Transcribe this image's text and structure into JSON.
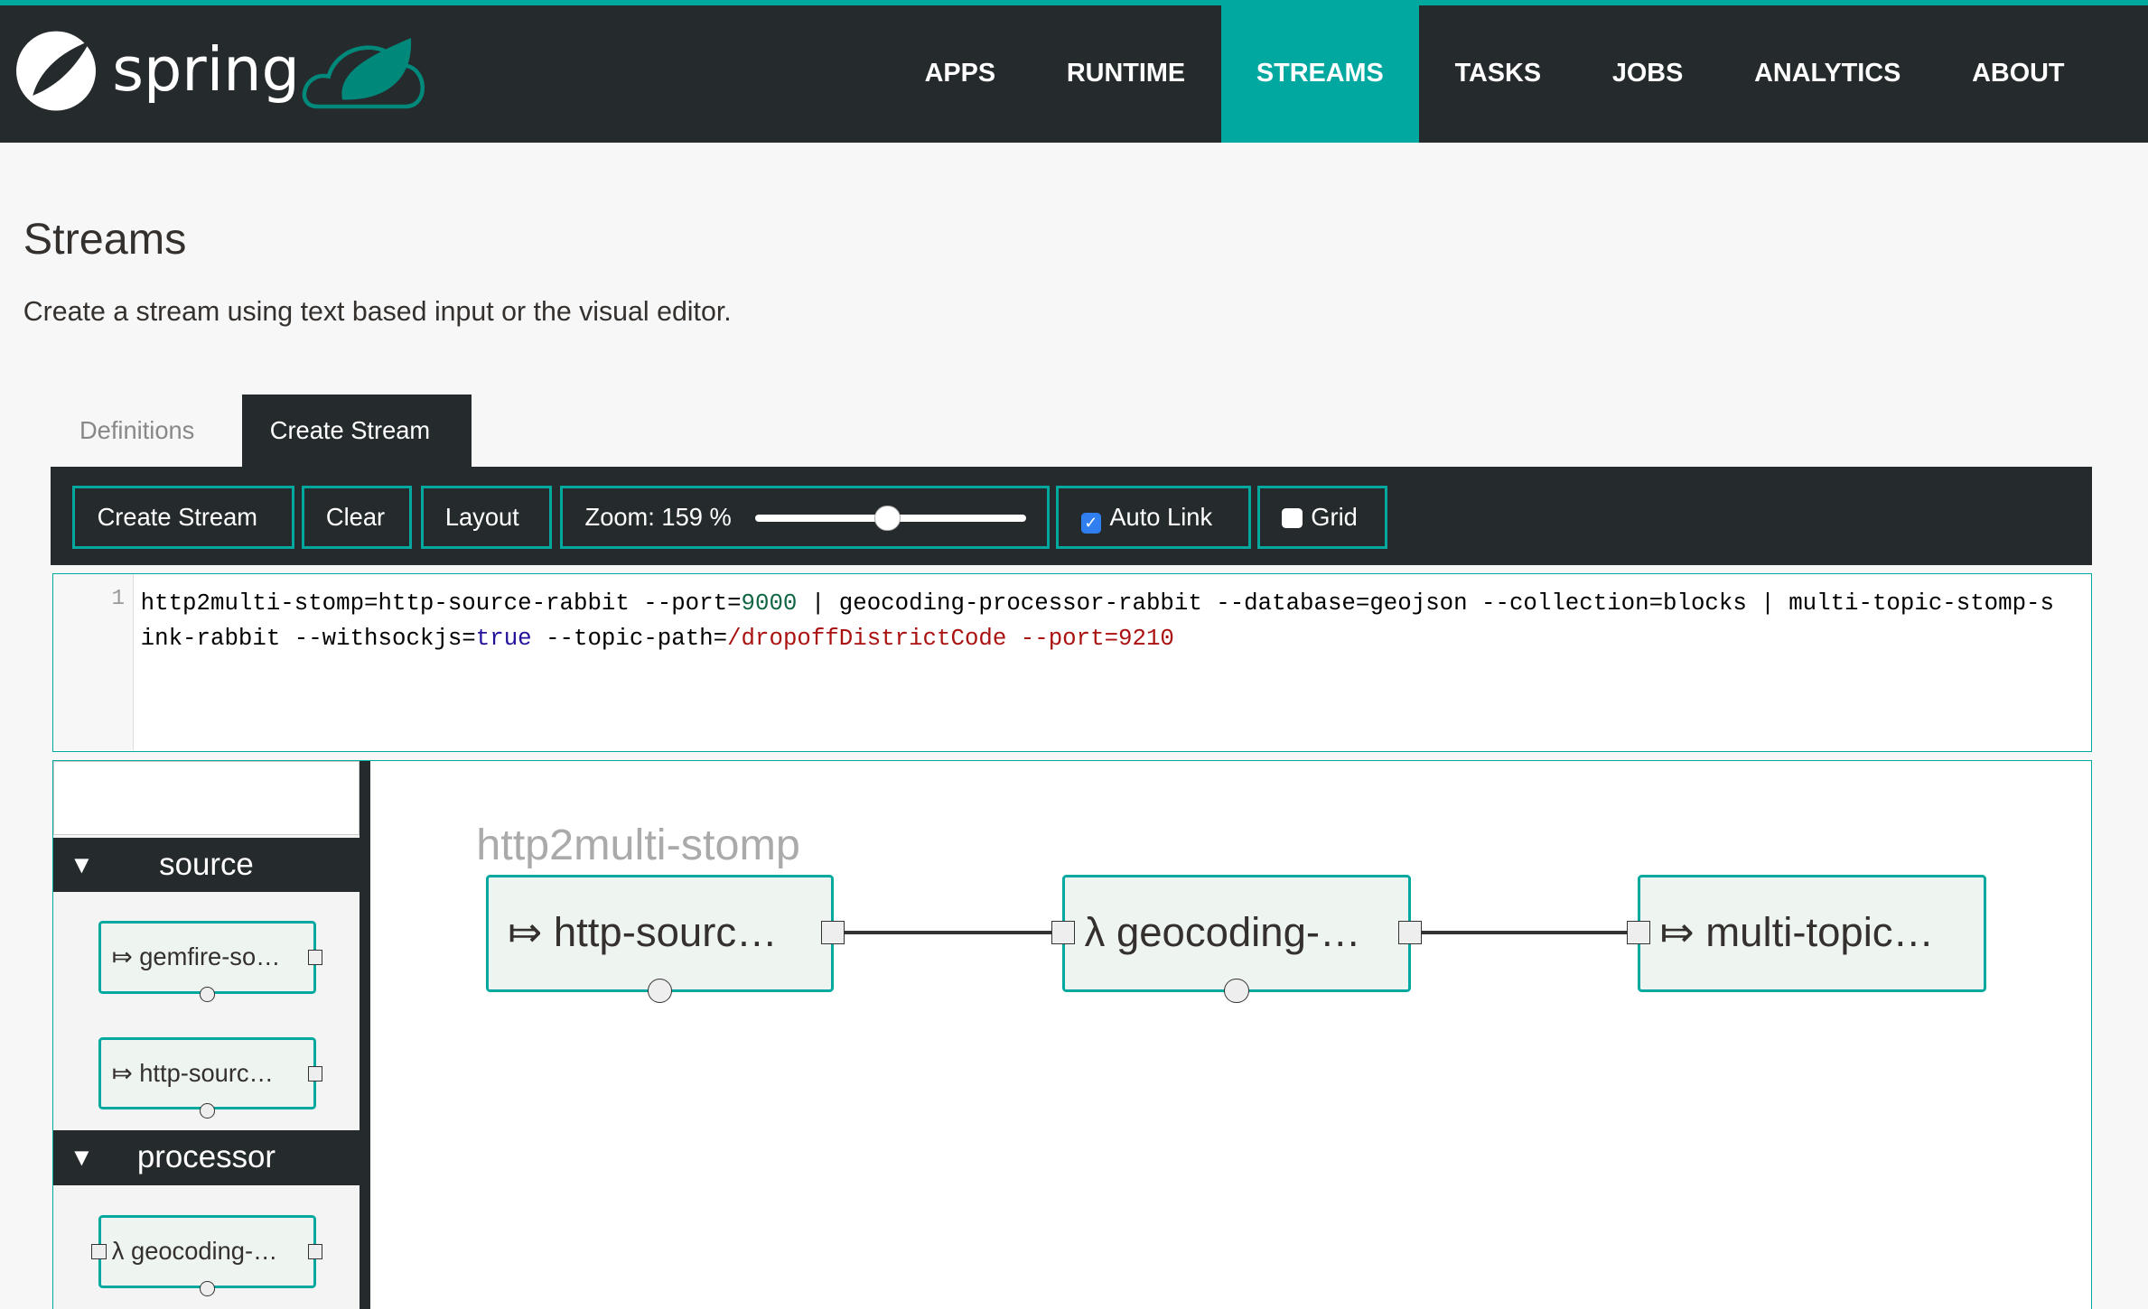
{
  "brand": {
    "logo_text": "spring"
  },
  "nav": {
    "items": [
      {
        "label": "APPS"
      },
      {
        "label": "RUNTIME"
      },
      {
        "label": "STREAMS",
        "active": true
      },
      {
        "label": "TASKS"
      },
      {
        "label": "JOBS"
      },
      {
        "label": "ANALYTICS"
      },
      {
        "label": "ABOUT"
      }
    ]
  },
  "page": {
    "title": "Streams",
    "subtitle": "Create a stream using text based input or the visual editor."
  },
  "tabs": [
    {
      "label": "Definitions"
    },
    {
      "label": "Create Stream",
      "active": true
    }
  ],
  "toolbar": {
    "create": "Create Stream",
    "clear": "Clear",
    "layout": "Layout",
    "zoom_label": "Zoom: 159 %",
    "zoom_value": 159,
    "auto_link": "Auto Link",
    "auto_link_checked": true,
    "grid": "Grid",
    "grid_checked": false
  },
  "editor": {
    "line_number": "1",
    "tokens": [
      {
        "t": "http2multi-stomp=http-source-rabbit --port=",
        "c": ""
      },
      {
        "t": "9000",
        "c": "num"
      },
      {
        "t": " | geocoding-processor-rabbit --database=geojson --collection=blocks | multi-topic-stomp-sink-rabbit --withsockjs=",
        "c": ""
      },
      {
        "t": "true",
        "c": "kw"
      },
      {
        "t": " --topic-path=",
        "c": ""
      },
      {
        "t": "/dropoffDistrictCode --port=9210",
        "c": "str"
      }
    ]
  },
  "palette": {
    "search_placeholder": "",
    "groups": [
      {
        "label": "source",
        "items": [
          {
            "icon": "⤇",
            "label": "gemfire-so…"
          },
          {
            "icon": "⤇",
            "label": "http-sourc…"
          }
        ]
      },
      {
        "label": "processor",
        "items": [
          {
            "icon": "λ",
            "label": "geocoding-…"
          }
        ]
      }
    ]
  },
  "canvas": {
    "stream_name": "http2multi-stomp",
    "nodes": [
      {
        "icon": "⤇",
        "label": "http-sourc…"
      },
      {
        "icon": "λ",
        "label": "geocoding-…"
      },
      {
        "icon": "⤇",
        "label": "multi-topic…"
      }
    ]
  },
  "colors": {
    "accent": "#00a8a0",
    "header": "#252a2d",
    "node_fill": "#eef4ef"
  }
}
